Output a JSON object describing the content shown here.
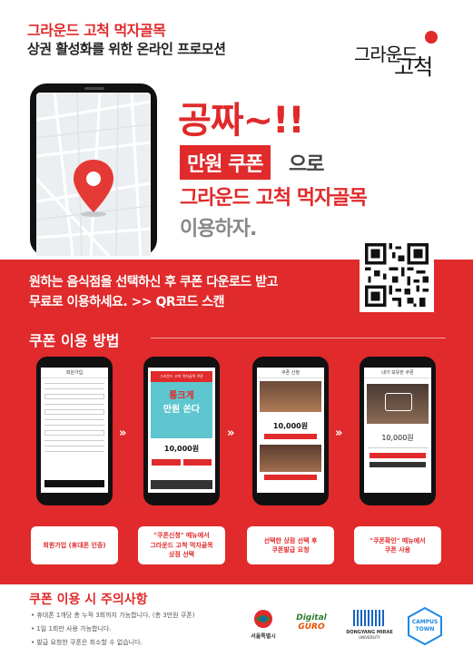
{
  "header": {
    "title": "그라운드 고척 먹자골목",
    "subtitle": "상권 활성화를 위한 온라인 프로모션",
    "logo_line1": "그라운드",
    "logo_line2": "고척"
  },
  "hero": {
    "headline": "공짜~!!",
    "coupon_highlight": "만원 쿠폰",
    "coupon_rest": "으로",
    "name": "그라운드 고척 먹자골목",
    "use": "이용하자."
  },
  "band": {
    "line1": "원하는 음식점을 선택하신 후 쿠폰 다운로드 받고",
    "line2": "무료로 이용하세요.  >> QR코드 스캔",
    "howto_title": "쿠폰 이용 방법"
  },
  "steps": [
    {
      "screen_title": "회원가입",
      "caption_lines": [
        "회원가입 (휴대폰 인증)"
      ]
    },
    {
      "screen_top": "그라운드 고척 먹자골목 쿠폰",
      "screen_big1": "통크게",
      "screen_big2": "만원 쏜다",
      "screen_amount": "10,000원",
      "caption_lines": [
        "\"쿠폰신청\" 메뉴에서",
        "그라운드 고척 먹자골목",
        "상점 선택"
      ]
    },
    {
      "screen_title": "쿠폰 신청",
      "screen_amount": "10,000원",
      "caption_lines": [
        "선택한 상점 선택 후",
        "쿠폰발급 요청"
      ]
    },
    {
      "screen_title": "내가 보유한 쿠폰",
      "screen_amount": "10,000원",
      "caption_lines": [
        "\"쿠폰확인\" 메뉴에서",
        "쿠폰 사용"
      ]
    }
  ],
  "arrow": "»",
  "caution": {
    "title": "쿠폰 이용 시 주의사항",
    "items": [
      "• 휴대폰 1개당 총 누적 3회까지 가능합니다. (총 3만원 쿠폰)",
      "• 1일 1회만 사용 가능합니다.",
      "• 발급 요청한 쿠폰은 취소할 수 없습니다."
    ]
  },
  "footer": {
    "seoul": "서울특별시",
    "digital": "Digital",
    "guro": "GURO",
    "dongyang": "DONGYANG MIRAE",
    "dongyang_sub": "UNIVERSITY",
    "campus1": "CAMPUS",
    "campus2": "TOWN"
  },
  "colors": {
    "brand_red": "#e02a2b",
    "text_dark": "#222222"
  },
  "icons": [
    "map-pin-icon",
    "qr-code-icon",
    "chevron-double-right-icon"
  ]
}
